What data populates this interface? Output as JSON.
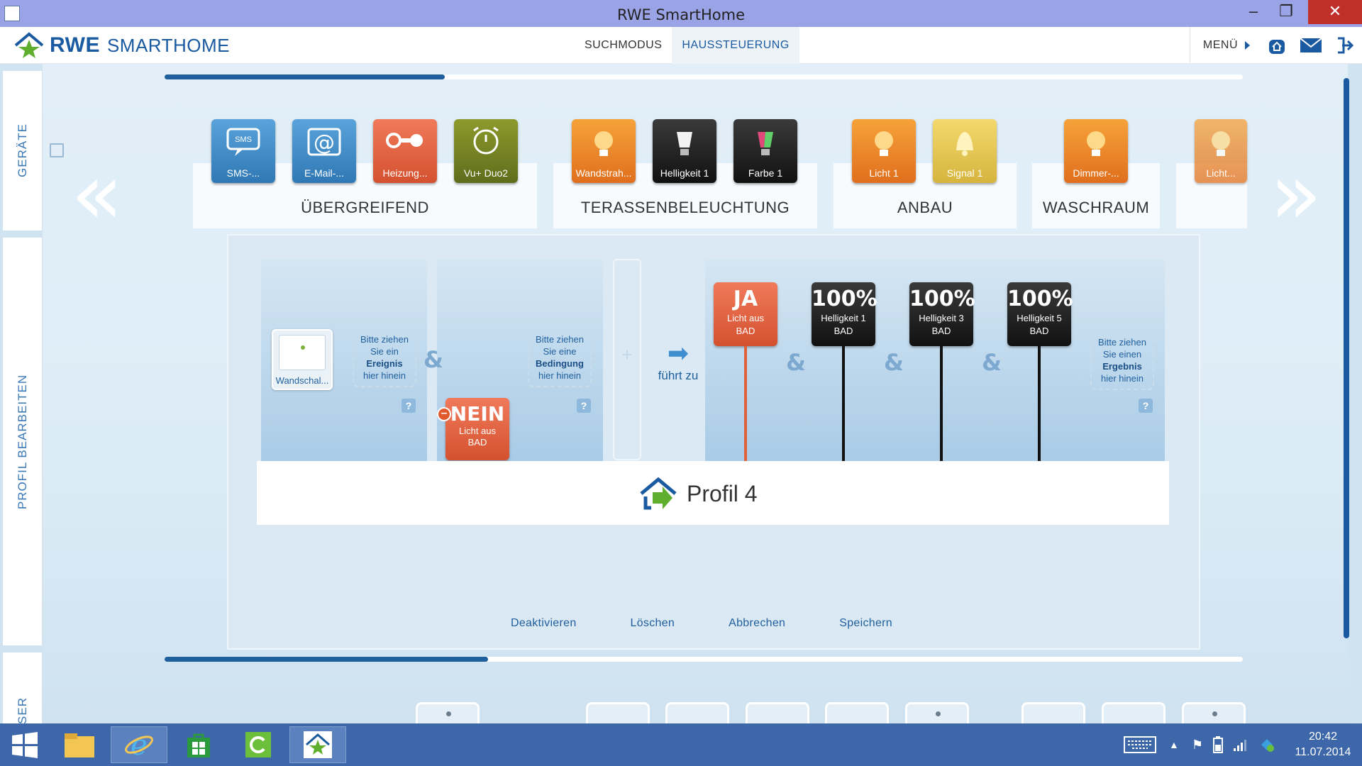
{
  "window": {
    "title": "RWE SmartHome"
  },
  "header": {
    "logo_bold": "RWE",
    "logo_light": "SMARTHOME",
    "tabs": [
      {
        "label": "SUCHMODUS",
        "active": false
      },
      {
        "label": "HAUSSTEUERUNG",
        "active": true
      }
    ],
    "menu_label": "MENÜ"
  },
  "sidebar": {
    "tabs": [
      "GERÄTE",
      "PROFIL BEARBEITEN",
      "SER"
    ]
  },
  "devices": {
    "scroll_progress": 0.26,
    "groups": [
      {
        "label": "ÜBERGREIFEND",
        "tiles": [
          {
            "label": "SMS-...",
            "icon": "sms-icon",
            "color": "#3d8ac8"
          },
          {
            "label": "E-Mail-...",
            "icon": "email-icon",
            "color": "#3d8ac8"
          },
          {
            "label": "Heizung...",
            "icon": "thermostat-icon",
            "color": "#e0603a"
          },
          {
            "label": "Vu+ Duo2",
            "icon": "power-clock-icon",
            "color": "#6f7e22"
          }
        ]
      },
      {
        "label": "TERASSENBELEUCHTUNG",
        "tiles": [
          {
            "label": "Wandstrah...",
            "icon": "bulb-icon",
            "color": "#ec8a2a"
          },
          {
            "label": "Helligkeit 1",
            "icon": "bulb-dark-icon",
            "color": "#222222"
          },
          {
            "label": "Farbe 1",
            "icon": "color-bulb-icon",
            "color": "#222222"
          }
        ]
      },
      {
        "label": "ANBAU",
        "tiles": [
          {
            "label": "Licht 1",
            "icon": "bulb-icon",
            "color": "#ec8a2a"
          },
          {
            "label": "Signal 1",
            "icon": "bell-icon",
            "color": "#e5c550"
          }
        ]
      },
      {
        "label": "WASCHRAUM",
        "tiles": [
          {
            "label": "Dimmer-...",
            "icon": "bulb-icon",
            "color": "#ec8a2a"
          }
        ]
      },
      {
        "label": "",
        "tiles": [
          {
            "label": "Licht...",
            "icon": "bulb-icon",
            "color": "#ec8a2a"
          }
        ]
      }
    ]
  },
  "editor": {
    "trigger_device": "Wandschal...",
    "drop_event": {
      "line1": "Bitte ziehen",
      "line2": "Sie ein",
      "bold": "Ereignis",
      "line3": "hier hinein"
    },
    "drop_condition": {
      "line1": "Bitte ziehen",
      "line2": "Sie eine",
      "bold": "Bedingung",
      "line3": "hier hinein"
    },
    "drop_result": {
      "line1": "Bitte ziehen",
      "line2": "Sie einen",
      "bold": "Ergebnis",
      "line3": "hier hinein"
    },
    "condition": {
      "value": "NEIN",
      "line1": "Licht aus",
      "line2": "BAD"
    },
    "leads_to": "führt zu",
    "plus": "+",
    "amp": "&",
    "help": "?",
    "results": [
      {
        "value": "JA",
        "line1": "Licht aus",
        "line2": "BAD",
        "color": "#e0603a"
      },
      {
        "value": "100%",
        "line1": "Helligkeit 1",
        "line2": "BAD",
        "color": "#222222"
      },
      {
        "value": "100%",
        "line1": "Helligkeit 3",
        "line2": "BAD",
        "color": "#222222"
      },
      {
        "value": "100%",
        "line1": "Helligkeit 5",
        "line2": "BAD",
        "color": "#222222"
      }
    ],
    "profile_name": "Profil 4",
    "buttons": [
      "Deaktivieren",
      "Löschen",
      "Abbrechen",
      "Speichern"
    ],
    "scroll_progress": 0.3
  },
  "taskbar": {
    "time": "20:42",
    "date": "11.07.2014"
  },
  "colors": {
    "brand": "#1a5aa0",
    "titlebar": "#9aa3e6",
    "taskbar": "#3d67a8"
  }
}
